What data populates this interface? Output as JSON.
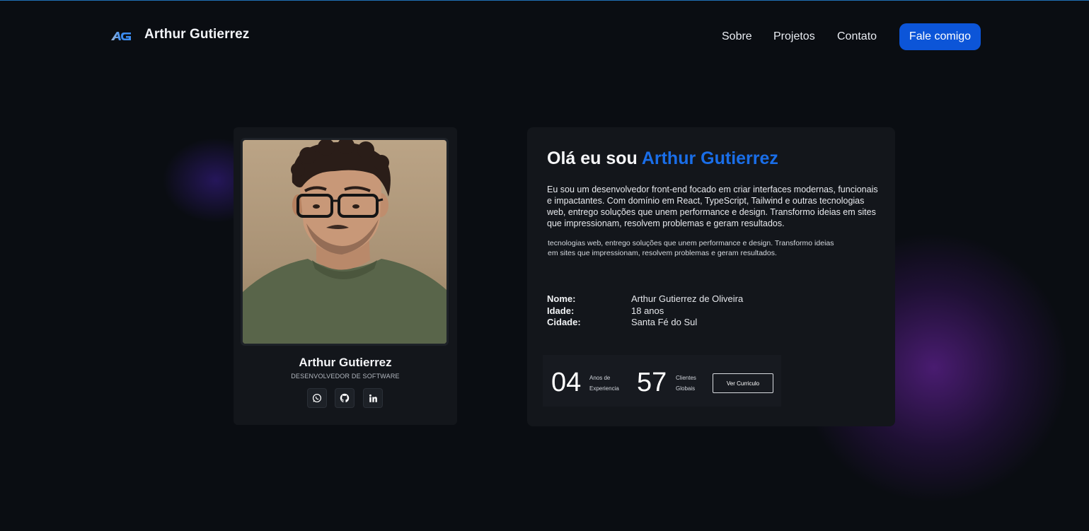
{
  "header": {
    "brand": "Arthur Gutierrez",
    "nav": [
      {
        "label": "Sobre"
      },
      {
        "label": "Projetos"
      },
      {
        "label": "Contato"
      }
    ],
    "cta_label": "Fale comigo"
  },
  "profile": {
    "name": "Arthur Gutierrez",
    "role": "DESENVOLVEDOR DE SOFTWARE",
    "socials": [
      {
        "icon": "whatsapp-icon"
      },
      {
        "icon": "github-icon"
      },
      {
        "icon": "linkedin-icon"
      }
    ]
  },
  "intro": {
    "greeting": "Olá eu sou ",
    "highlight_name": "Arthur Gutierrez",
    "bio": "Eu sou um desenvolvedor front-end focado em criar interfaces modernas, funcionais e impactantes. Com domínio em React, TypeScript, Tailwind e outras tecnologias web, entrego soluções que unem performance e design. Transformo ideias em sites que impressionam, resolvem problemas e geram resultados.",
    "bio_echo": "tecnologias web, entrego soluções que unem performance e design. Transformo ideias em sites que impressionam, resolvem problemas e geram resultados.",
    "details": [
      {
        "label": "Nome:",
        "value": "Arthur Gutierrez de Oliveira"
      },
      {
        "label": "Idade:",
        "value": "18 anos"
      },
      {
        "label": "Cidade:",
        "value": "Santa Fé do Sul"
      }
    ]
  },
  "stats": {
    "years_value": "04",
    "years_caption_1": "Anos de",
    "years_caption_2": "Experiencia",
    "clients_value": "57",
    "clients_caption_1": "Clientes",
    "clients_caption_2": "Globais",
    "cv_label": "Ver Curriculo"
  },
  "colors": {
    "background": "#0a0d12",
    "card": "#13161b",
    "accent": "#1a6ee8",
    "cta": "#0c55d8",
    "glow": "#7d28be"
  }
}
